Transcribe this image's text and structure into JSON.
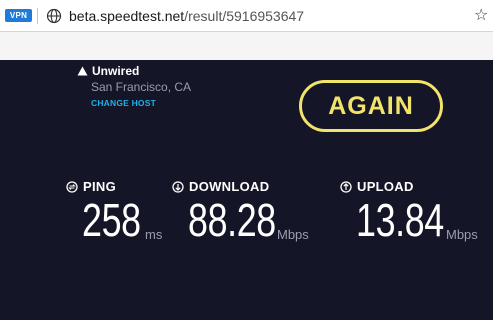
{
  "browser": {
    "vpn_badge": "VPN",
    "url_host": "beta.speedtest.net",
    "url_path": "/result/5916953647",
    "bookmark_icon": "star-icon",
    "site_icon": "globe-icon"
  },
  "server": {
    "isp_icon": "person-icon",
    "isp_name": "Unwired",
    "location": "San Francisco, CA",
    "change_host_label": "CHANGE HOST"
  },
  "again_button": {
    "label": "AGAIN"
  },
  "metrics": {
    "ping": {
      "label": "PING",
      "value": "258",
      "unit": "ms",
      "icon": "ping-icon"
    },
    "download": {
      "label": "DOWNLOAD",
      "value": "88.28",
      "unit": "Mbps",
      "icon": "download-arrow-icon"
    },
    "upload": {
      "label": "UPLOAD",
      "value": "13.84",
      "unit": "Mbps",
      "icon": "upload-arrow-icon"
    }
  },
  "colors": {
    "panel_bg": "#141526",
    "accent_yellow": "#f2e46a",
    "link_blue": "#1fb0e6",
    "muted_text": "#9a9cb0",
    "vpn_blue": "#1f7ad9"
  }
}
